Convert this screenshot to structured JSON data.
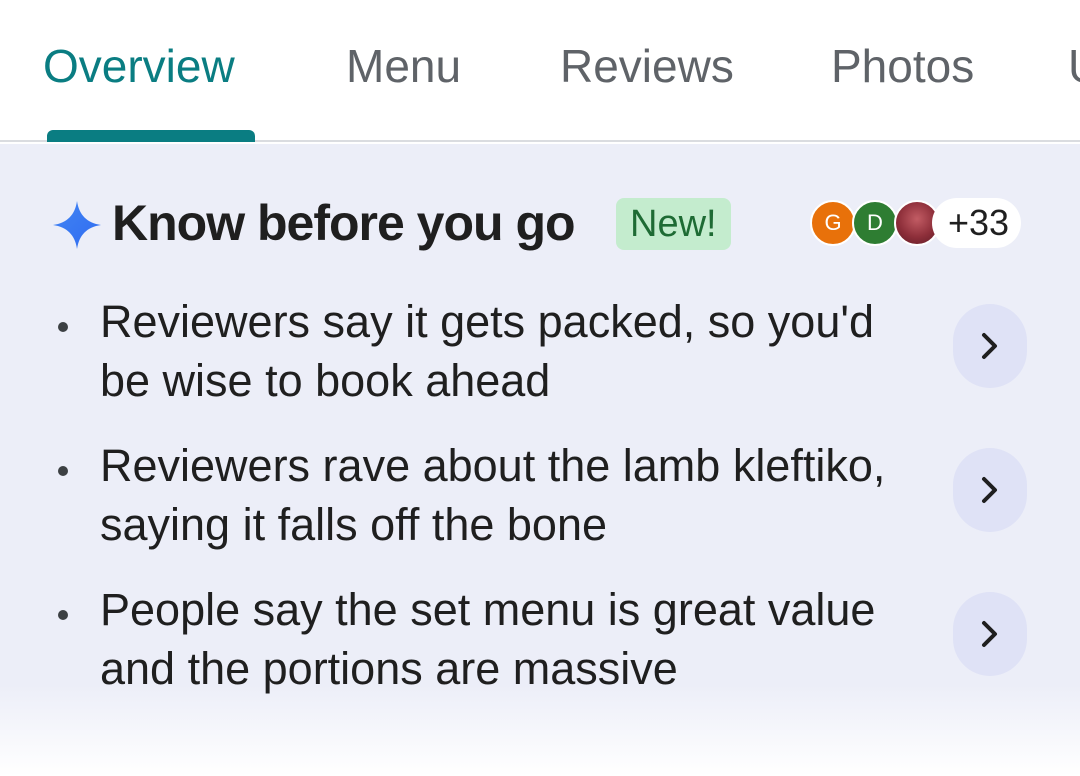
{
  "tabs": [
    {
      "label": "Overview",
      "active": true
    },
    {
      "label": "Menu",
      "active": false
    },
    {
      "label": "Reviews",
      "active": false
    },
    {
      "label": "Photos",
      "active": false
    }
  ],
  "colors": {
    "accent": "#0a7d82",
    "badge_bg": "#c4ecce",
    "card_bg": "#eceef8",
    "chevron_button_bg": "#dfe2f6"
  },
  "card": {
    "icon": "sparkle-icon",
    "title": "Know before you go",
    "badge": "New!",
    "avatars": [
      {
        "initial": "G",
        "color": "#e8710a"
      },
      {
        "initial": "D",
        "color": "#2e7d32"
      },
      {
        "initial": "",
        "type": "photo"
      }
    ],
    "more_count": "+33",
    "items": [
      {
        "text": "Reviewers say it gets packed, so you'd be wise to book ahead",
        "icon": "chevron-right-icon"
      },
      {
        "text": "Reviewers rave about the lamb kleftiko, saying it falls off the bone",
        "icon": "chevron-right-icon"
      },
      {
        "text": "People say the set menu is great value and the portions are massive",
        "icon": "chevron-right-icon"
      }
    ]
  }
}
